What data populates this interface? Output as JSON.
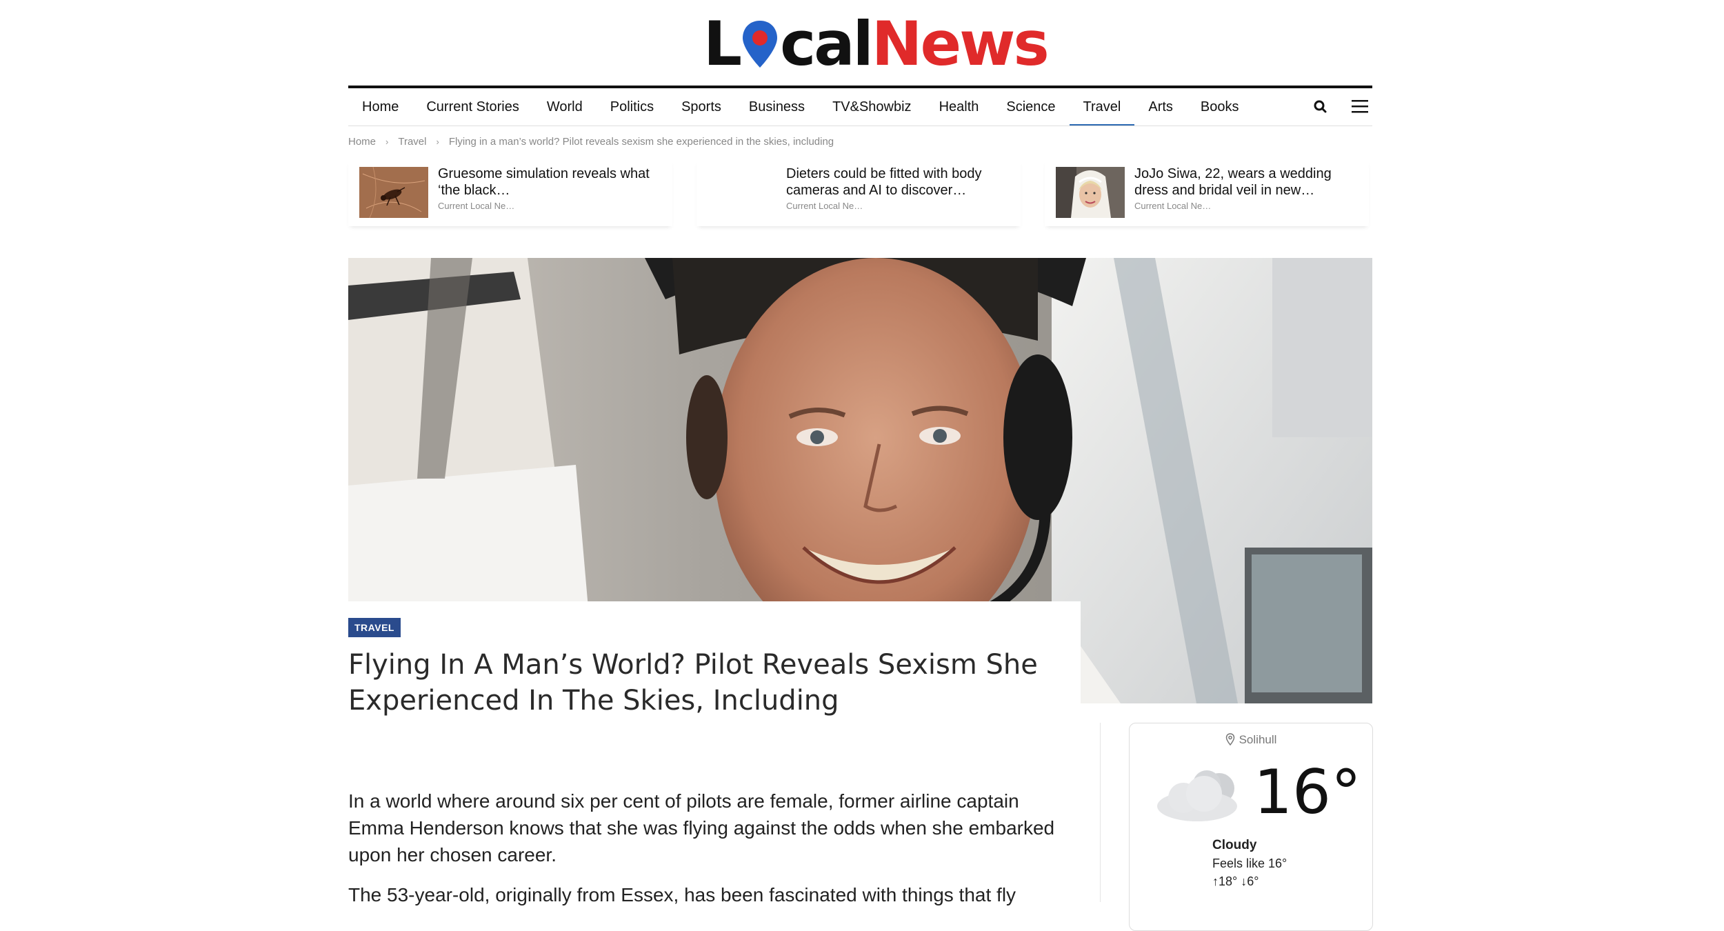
{
  "brand": {
    "logo_part1": "L",
    "logo_part2": "cal",
    "logo_part3": "News",
    "colors": {
      "dark": "#111111",
      "red": "#e02a2a",
      "pin_blue": "#2563c9",
      "accent": "#2a4b8d"
    }
  },
  "nav": {
    "items": [
      {
        "label": "Home"
      },
      {
        "label": "Current Stories"
      },
      {
        "label": "World"
      },
      {
        "label": "Politics"
      },
      {
        "label": "Sports"
      },
      {
        "label": "Business"
      },
      {
        "label": "TV&Showbiz"
      },
      {
        "label": "Health"
      },
      {
        "label": "Science"
      },
      {
        "label": "Travel"
      },
      {
        "label": "Arts"
      },
      {
        "label": "Books"
      }
    ],
    "active": "Travel",
    "search_icon": "search-icon",
    "menu_icon": "hamburger-menu-icon"
  },
  "breadcrumb": {
    "home": "Home",
    "category": "Travel",
    "current": "Flying in a man’s world? Pilot reveals sexism she experienced in the skies, including"
  },
  "related": [
    {
      "title": "Gruesome simulation reveals what ‘the black…",
      "source": "Current Local Ne…"
    },
    {
      "title": "Dieters could be fitted with body cameras and AI to discover…",
      "source": "Current Local Ne…"
    },
    {
      "title": "JoJo Siwa, 22, wears a wedding dress and bridal veil in new…",
      "source": "Current Local Ne…"
    }
  ],
  "article": {
    "category": "TRAVEL",
    "headline": "Flying In A Man’s World? Pilot Reveals Sexism She Experienced In The Skies, Including",
    "paragraphs": [
      "In a world where around six per cent of pilots are female, former airline captain Emma Henderson knows that she was flying against the odds when she embarked upon her chosen career.",
      "The 53-year-old, originally from Essex, has been fascinated with things that fly"
    ]
  },
  "weather": {
    "location": "Solihull",
    "temperature": "16°",
    "condition": "Cloudy",
    "feels_like": "Feels like 16°",
    "high_low": "↑18° ↓6°",
    "icon": "cloud-icon"
  }
}
